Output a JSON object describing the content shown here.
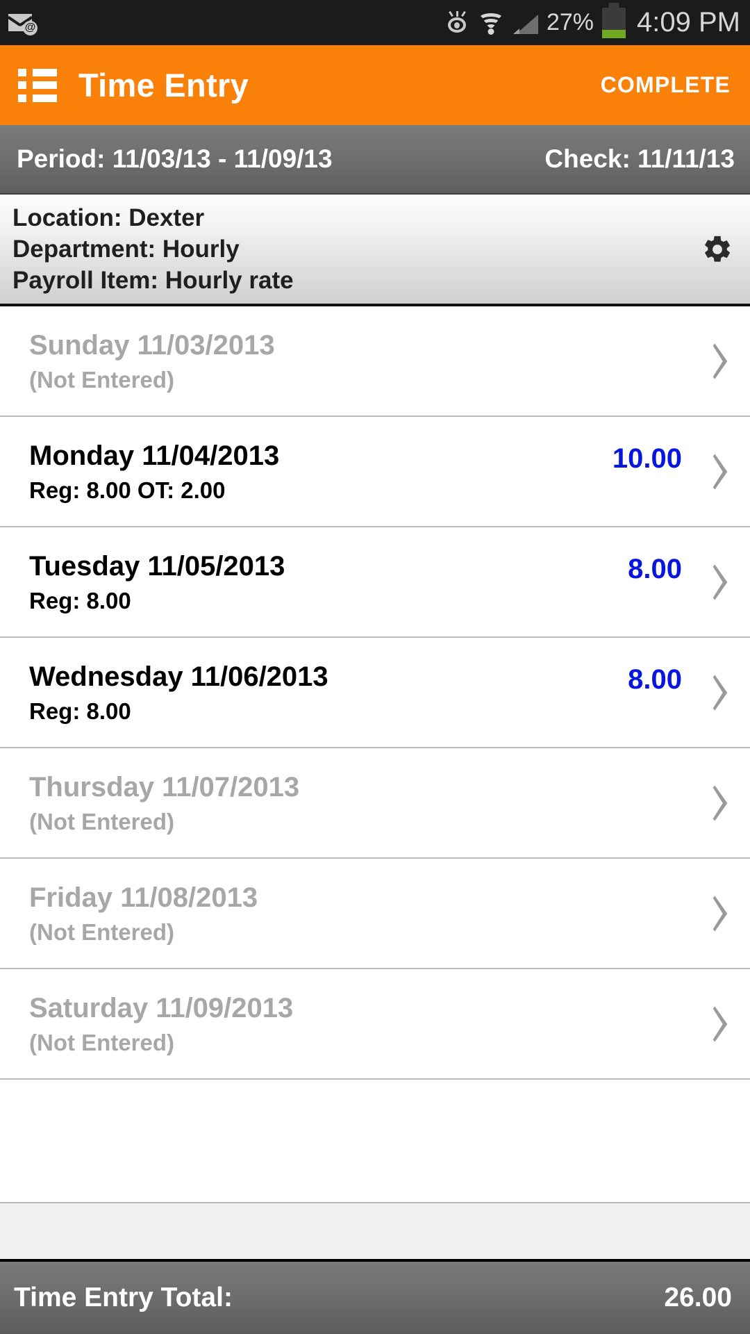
{
  "status_bar": {
    "mail_icon": "email-at-icon",
    "eye_icon": "eye-icon",
    "wifi_icon": "wifi-icon",
    "signal_icon": "cellular-signal-icon",
    "battery_percent": "27%",
    "battery_level": 27,
    "battery_icon": "battery-icon",
    "time": "4:09 PM"
  },
  "action_bar": {
    "menu_icon": "list-menu-icon",
    "title": "Time Entry",
    "complete_label": "COMPLETE",
    "background_color": "#f98109"
  },
  "period_bar": {
    "period": "Period: 11/03/13 - 11/09/13",
    "check": "Check: 11/11/13"
  },
  "info_panel": {
    "location": "Location: Dexter",
    "department": "Department: Hourly",
    "payroll_item": "Payroll Item: Hourly rate",
    "settings_icon": "gear-icon"
  },
  "days": [
    {
      "name": "Sunday 11/03/2013",
      "sub": "(Not Entered)",
      "value": "",
      "entered": false
    },
    {
      "name": "Monday 11/04/2013",
      "sub": "Reg: 8.00 OT: 2.00",
      "value": "10.00",
      "entered": true
    },
    {
      "name": "Tuesday 11/05/2013",
      "sub": "Reg: 8.00",
      "value": "8.00",
      "entered": true
    },
    {
      "name": "Wednesday 11/06/2013",
      "sub": "Reg: 8.00",
      "value": "8.00",
      "entered": true
    },
    {
      "name": "Thursday 11/07/2013",
      "sub": "(Not Entered)",
      "value": "",
      "entered": false
    },
    {
      "name": "Friday 11/08/2013",
      "sub": "(Not Entered)",
      "value": "",
      "entered": false
    },
    {
      "name": "Saturday 11/09/2013",
      "sub": "(Not Entered)",
      "value": "",
      "entered": false
    }
  ],
  "total_bar": {
    "label": "Time Entry Total:",
    "value": "26.00"
  },
  "colors": {
    "accent_orange": "#f98109",
    "value_blue": "#0715e0",
    "disabled_gray": "#a7a7a7",
    "battery_green": "#6fa821"
  }
}
